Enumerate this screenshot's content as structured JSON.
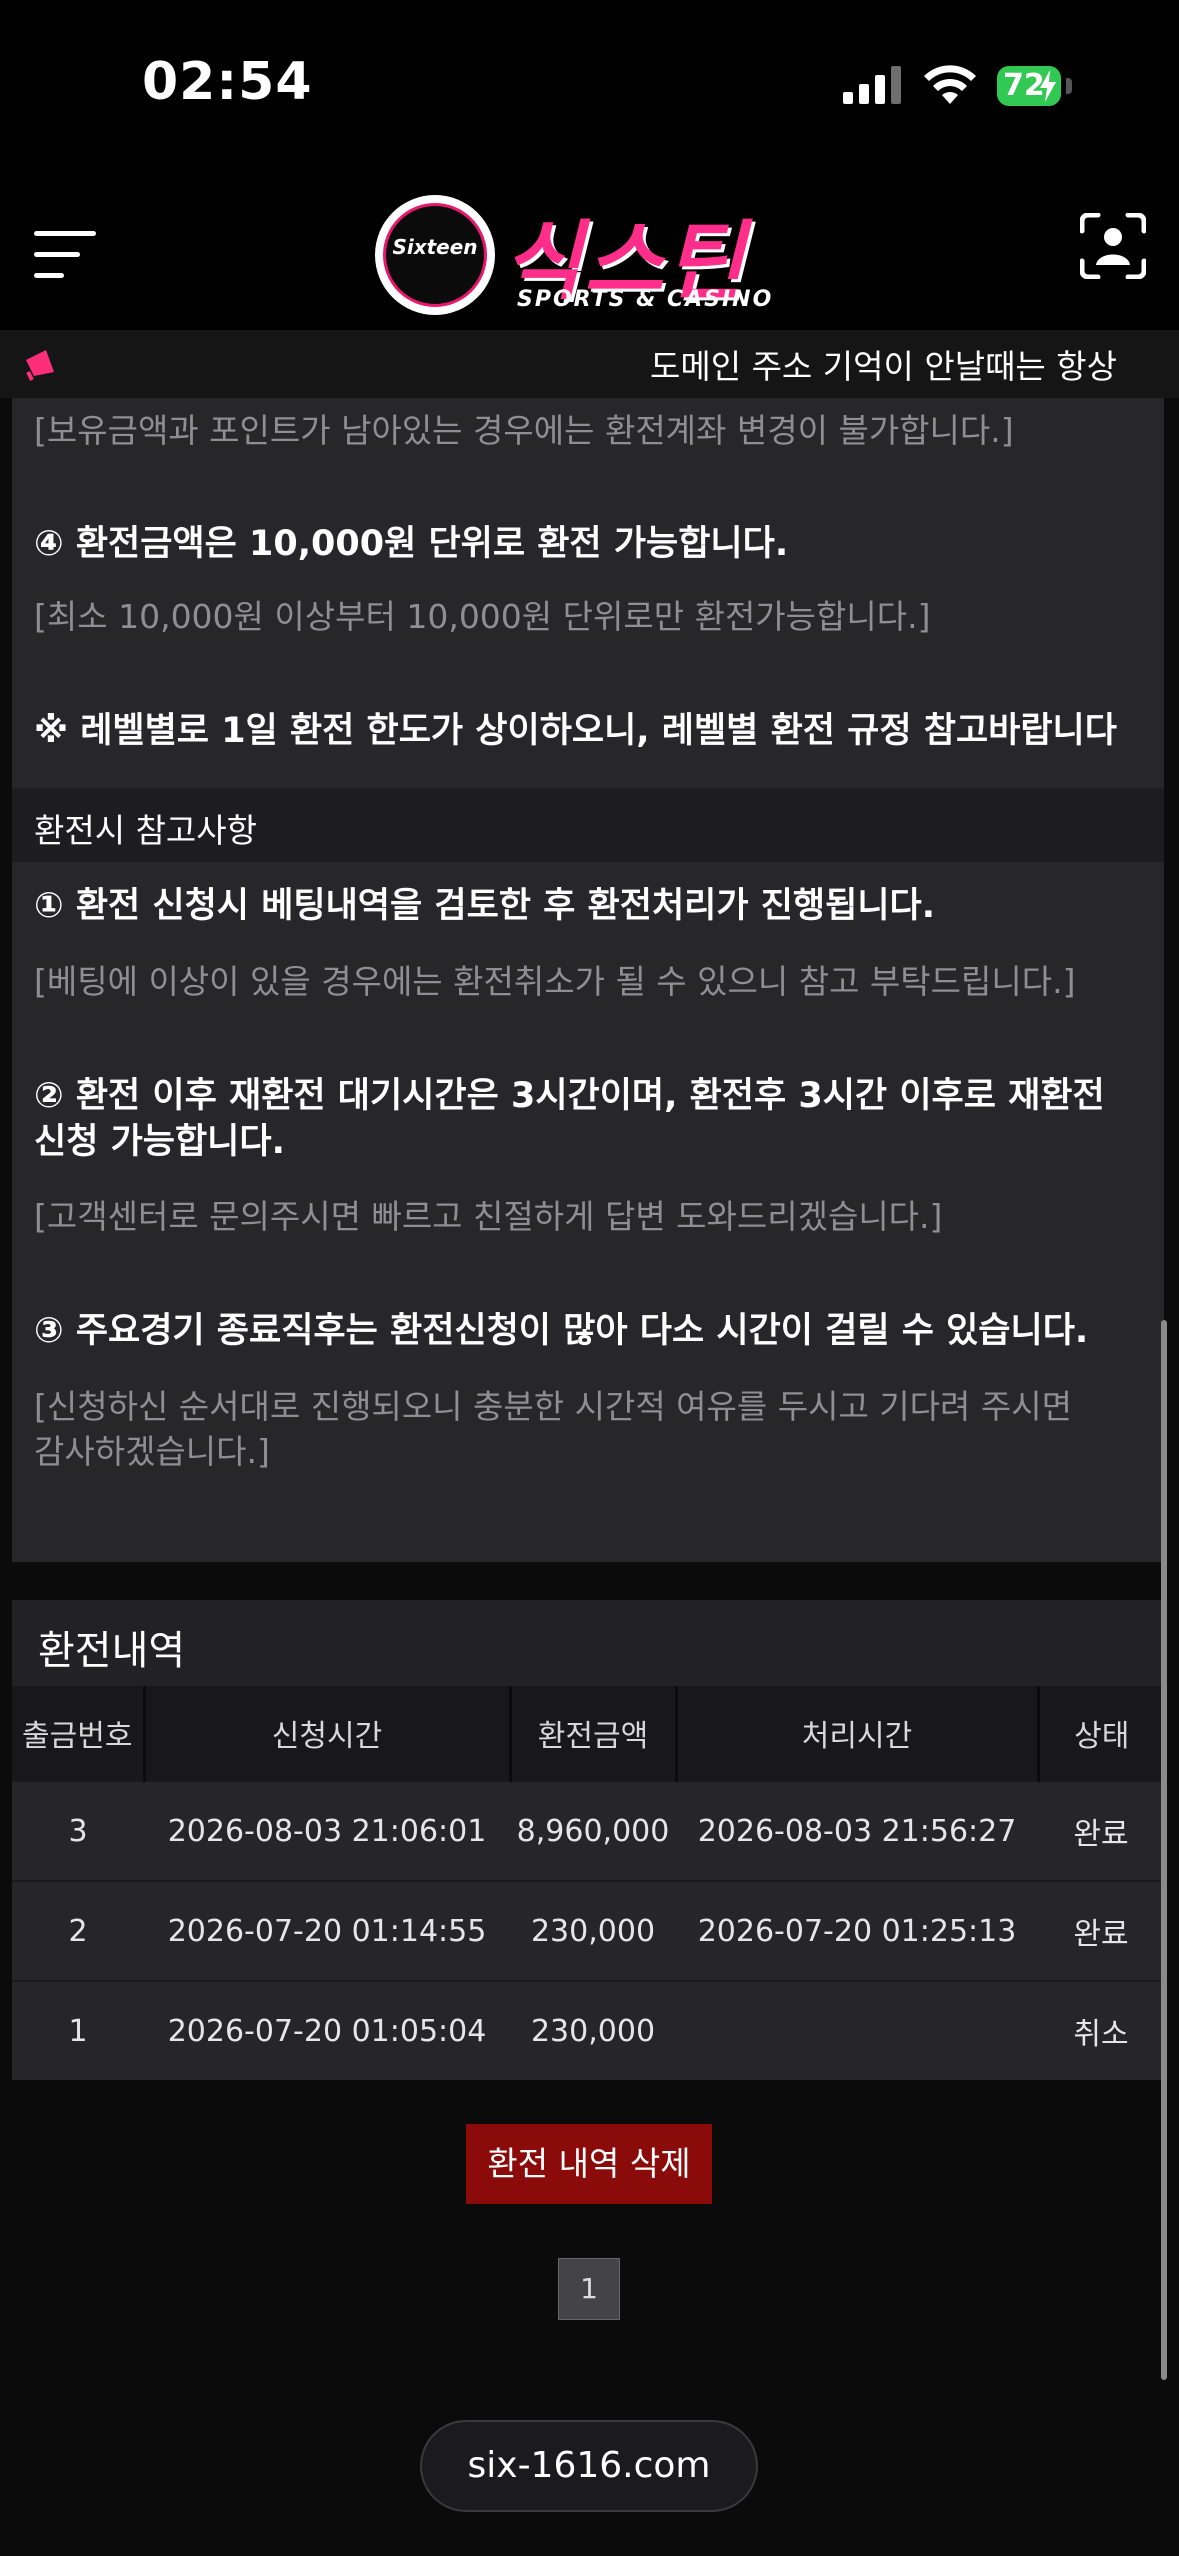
{
  "status_bar": {
    "time": "02:54",
    "battery": "72"
  },
  "header": {
    "logo_word": "Sixteen",
    "logo_korean": "식스틴",
    "logo_sub": "SPORTS & CASINO"
  },
  "ticker": {
    "text": "도메인 주소 기억이 안날때는 항상"
  },
  "notice": {
    "line_top": "[보유금액과 포인트가 남아있는 경우에는 환전계좌 변경이 불가합니다.]",
    "item4_title": "④ 환전금액은 10,000원 단위로 환전 가능합니다.",
    "item4_desc": "[최소 10,000원 이상부터 10,000원 단위로만 환전가능합니다.]",
    "level_note": "※ 레벨별로 1일 환전 한도가 상이하오니, 레벨별 환전 규정 참고바랍니다"
  },
  "reference": {
    "heading": "환전시 참고사항",
    "item1_title": "① 환전 신청시 베팅내역을 검토한 후 환전처리가 진행됩니다.",
    "item1_desc": "[베팅에 이상이 있을 경우에는 환전취소가 될 수 있으니 참고 부탁드립니다.]",
    "item2_title_line1": "② 환전 이후 재환전 대기시간은 3시간이며, 환전후 3시간 이후로 재환전",
    "item2_title_line2": "신청 가능합니다.",
    "item2_desc": "[고객센터로 문의주시면 빠르고 친절하게 답변 도와드리겠습니다.]",
    "item3_title": "③ 주요경기 종료직후는 환전신청이 많아 다소 시간이 걸릴 수 있습니다.",
    "item3_desc_line1": "[신청하신 순서대로 진행되오니 충분한 시간적 여유를 두시고 기다려 주시면",
    "item3_desc_line2": "감사하겠습니다.]"
  },
  "history": {
    "title": "환전내역",
    "columns": [
      "출금번호",
      "신청시간",
      "환전금액",
      "처리시간",
      "상태"
    ],
    "rows": [
      [
        "3",
        "2026-08-03 21:06:01",
        "8,960,000",
        "2026-08-03 21:56:27",
        "완료"
      ],
      [
        "2",
        "2026-07-20 01:14:55",
        "230,000",
        "2026-07-20 01:25:13",
        "완료"
      ],
      [
        "1",
        "2026-07-20 01:05:04",
        "230,000",
        "",
        "취소"
      ]
    ],
    "delete_button": "환전 내역 삭제",
    "page": "1"
  },
  "browser": {
    "url": "six-1616.com"
  }
}
